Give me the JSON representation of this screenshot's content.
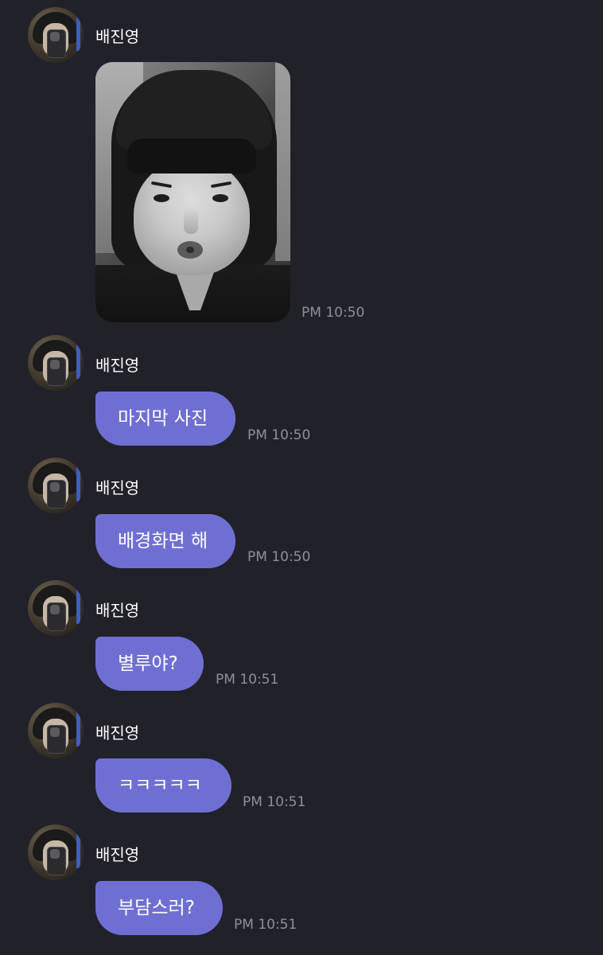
{
  "messages": [
    {
      "sender": "배진영",
      "type": "image",
      "time": "PM 10:50"
    },
    {
      "sender": "배진영",
      "type": "text",
      "text": "마지막 사진",
      "time": "PM 10:50"
    },
    {
      "sender": "배진영",
      "type": "text",
      "text": "배경화면 해",
      "time": "PM 10:50"
    },
    {
      "sender": "배진영",
      "type": "text",
      "text": "별루야?",
      "time": "PM 10:51"
    },
    {
      "sender": "배진영",
      "type": "text",
      "text": "ㅋㅋㅋㅋㅋ",
      "time": "PM 10:51"
    },
    {
      "sender": "배진영",
      "type": "text",
      "text": "부담스러?",
      "time": "PM 10:51"
    }
  ],
  "colors": {
    "background": "#21212a",
    "bubble": "#6f6fd3",
    "time": "#8f8f97"
  }
}
